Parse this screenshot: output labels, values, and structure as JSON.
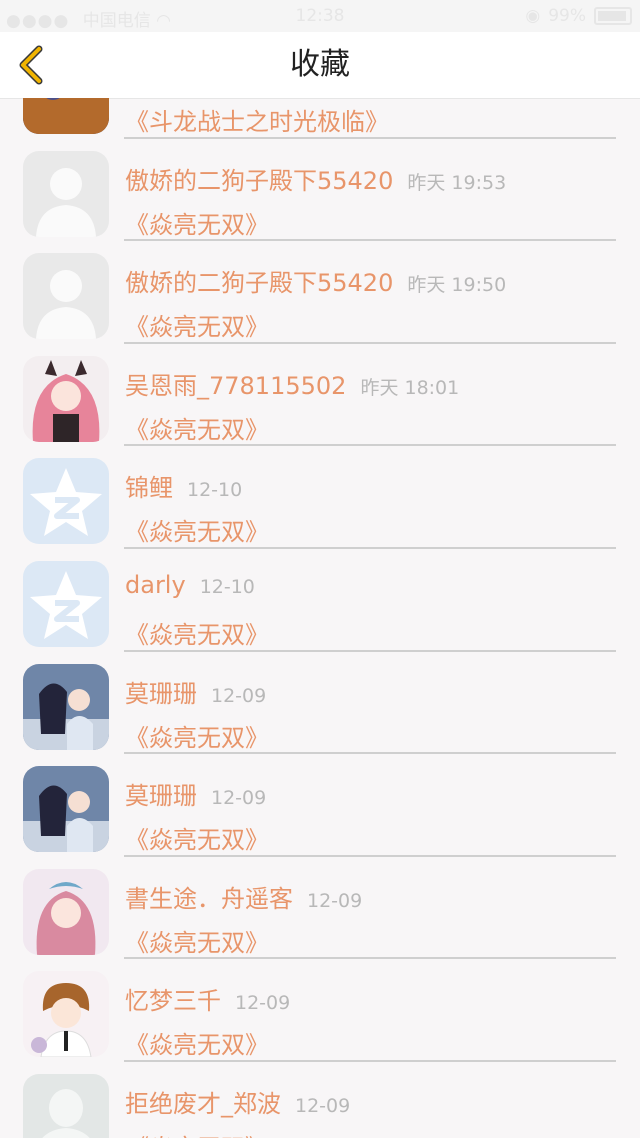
{
  "status_bar": {
    "carrier": "中国电信",
    "time": "12:38",
    "battery": "99%"
  },
  "nav": {
    "title": "收藏",
    "back_icon": "chevron-left-icon",
    "accent_color": "#f0b400"
  },
  "colors": {
    "name_text": "#e8956a",
    "time_text": "#b8b8b8",
    "divider": "#cfcfcf"
  },
  "items": [
    {
      "name": "",
      "time": "",
      "book": "《斗龙战士之时光极临》",
      "avatar": "dark-photo"
    },
    {
      "name": "傲娇的二狗子殿下55420",
      "time": "昨天 19:53",
      "book": "《焱亮无双》",
      "avatar": "default-person-icon"
    },
    {
      "name": "傲娇的二狗子殿下55420",
      "time": "昨天 19:50",
      "book": "《焱亮无双》",
      "avatar": "default-person-icon"
    },
    {
      "name": "吴恩雨_778115502",
      "time": "昨天 18:01",
      "book": "《焱亮无双》",
      "avatar": "anime-pink-hair"
    },
    {
      "name": "锦鲤",
      "time": "12-10",
      "book": "《焱亮无双》",
      "avatar": "qq-star-icon"
    },
    {
      "name": "darly",
      "time": "12-10",
      "book": "《焱亮无双》",
      "avatar": "qq-star-icon"
    },
    {
      "name": "莫珊珊",
      "time": "12-09",
      "book": "《焱亮无双》",
      "avatar": "anime-duo"
    },
    {
      "name": "莫珊珊",
      "time": "12-09",
      "book": "《焱亮无双》",
      "avatar": "anime-duo"
    },
    {
      "name": "書生途．舟遥客",
      "time": "12-09",
      "book": "《焱亮无双》",
      "avatar": "anime-girl-crown"
    },
    {
      "name": "忆梦三千",
      "time": "12-09",
      "book": "《焱亮无双》",
      "avatar": "anime-boy"
    },
    {
      "name": "拒绝废才_郑波",
      "time": "12-09",
      "book": "《焱亮无双》",
      "avatar": "default-person-light"
    }
  ]
}
